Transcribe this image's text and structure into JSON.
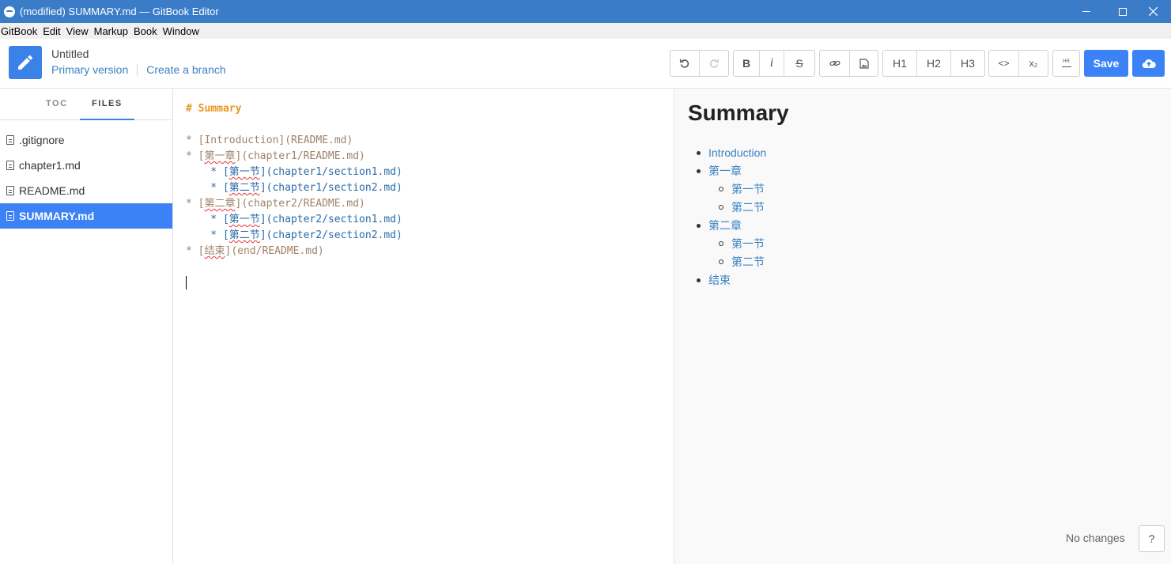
{
  "window": {
    "title": "(modified) SUMMARY.md — GitBook Editor"
  },
  "menu": [
    "GitBook",
    "Edit",
    "View",
    "Markup",
    "Book",
    "Window"
  ],
  "header": {
    "book_title": "Untitled",
    "version": "Primary version",
    "branch_link": "Create a branch",
    "toolbar": {
      "bold": "B",
      "italic": "i",
      "strike": "S",
      "h1": "H1",
      "h2": "H2",
      "h3": "H3",
      "code": "<>",
      "sub": "x₂",
      "hr": "HR",
      "save": "Save"
    }
  },
  "sidebar": {
    "tabs": [
      "TOC",
      "FILES"
    ],
    "active_tab": "FILES",
    "files": [
      ".gitignore",
      "chapter1.md",
      "README.md",
      "SUMMARY.md"
    ],
    "active_file": "SUMMARY.md"
  },
  "editor": {
    "heading": "# Summary",
    "lines": [
      {
        "indent": "",
        "bullet": "* ",
        "label": "Introduction",
        "path": "README.md"
      },
      {
        "indent": "",
        "bullet": "* ",
        "label": "第一章",
        "path": "chapter1/README.md"
      },
      {
        "indent": "    ",
        "bullet": "* ",
        "label": "第一节",
        "path": "chapter1/section1.md"
      },
      {
        "indent": "    ",
        "bullet": "* ",
        "label": "第二节",
        "path": "chapter1/section2.md"
      },
      {
        "indent": "",
        "bullet": "* ",
        "label": "第二章",
        "path": "chapter2/README.md"
      },
      {
        "indent": "    ",
        "bullet": "* ",
        "label": "第一节",
        "path": "chapter2/section1.md"
      },
      {
        "indent": "    ",
        "bullet": "* ",
        "label": "第二节",
        "path": "chapter2/section2.md"
      },
      {
        "indent": "",
        "bullet": "* ",
        "label": "结束",
        "path": "end/README.md"
      }
    ]
  },
  "preview": {
    "title": "Summary",
    "items": [
      {
        "label": "Introduction",
        "level": 1
      },
      {
        "label": "第一章",
        "level": 1
      },
      {
        "label": "第一节",
        "level": 2
      },
      {
        "label": "第二节",
        "level": 2
      },
      {
        "label": "第二章",
        "level": 1
      },
      {
        "label": "第一节",
        "level": 2
      },
      {
        "label": "第二节",
        "level": 2
      },
      {
        "label": "结束",
        "level": 1
      }
    ]
  },
  "status": {
    "text": "No changes",
    "help": "?"
  },
  "colors": {
    "titlebar": "#3b7cc8",
    "accent": "#3b82f6",
    "link": "#3b82c4",
    "markdown_heading": "#e6961e",
    "markdown_text": "#a0826a",
    "markdown_nested": "#2a6aa8"
  }
}
